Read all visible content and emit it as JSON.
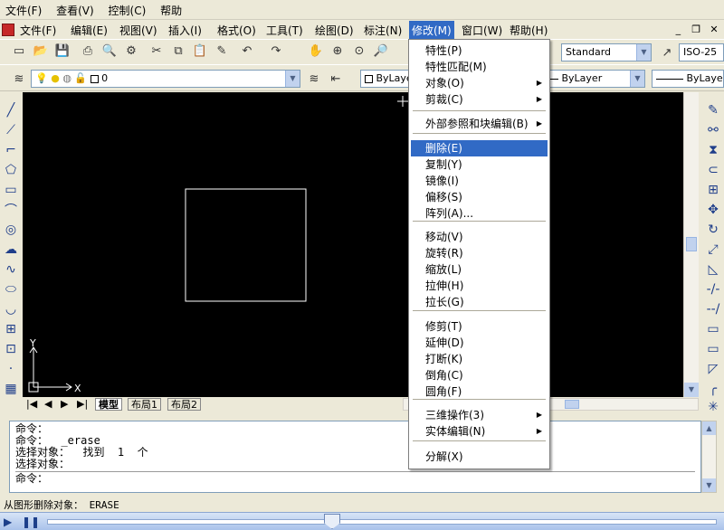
{
  "os_menu": [
    "文件(F)",
    "查看(V)",
    "控制(C)",
    "帮助"
  ],
  "app_menu": {
    "items": [
      "文件(F)",
      "编辑(E)",
      "视图(V)",
      "插入(I)",
      "格式(O)",
      "工具(T)",
      "绘图(D)",
      "标注(N)",
      "修改(M)",
      "窗口(W)",
      "帮助(H)"
    ],
    "active": "修改(M)"
  },
  "window_buttons": [
    "_",
    "❐",
    "✕"
  ],
  "toolbar": {
    "text_style": "Standard",
    "dim_style": "ISO-25",
    "layer": "0",
    "color": "ByLayer",
    "linetype": "ByLayer",
    "lineweight": "ByLayer"
  },
  "modify_menu": {
    "items": [
      {
        "label": "特性(P)",
        "submenu": false
      },
      {
        "label": "特性匹配(M)",
        "submenu": false
      },
      {
        "label": "对象(O)",
        "submenu": true
      },
      {
        "label": "剪裁(C)",
        "submenu": true
      },
      {
        "sep": true
      },
      {
        "label": "外部参照和块编辑(B)",
        "submenu": true
      },
      {
        "sep": true
      },
      {
        "label": "删除(E)",
        "submenu": false,
        "highlight": true
      },
      {
        "label": "复制(Y)",
        "submenu": false
      },
      {
        "label": "镜像(I)",
        "submenu": false
      },
      {
        "label": "偏移(S)",
        "submenu": false
      },
      {
        "label": "阵列(A)...",
        "submenu": false
      },
      {
        "sep": true
      },
      {
        "label": "移动(V)",
        "submenu": false
      },
      {
        "label": "旋转(R)",
        "submenu": false
      },
      {
        "label": "缩放(L)",
        "submenu": false
      },
      {
        "label": "拉伸(H)",
        "submenu": false
      },
      {
        "label": "拉长(G)",
        "submenu": false
      },
      {
        "sep": true
      },
      {
        "label": "修剪(T)",
        "submenu": false
      },
      {
        "label": "延伸(D)",
        "submenu": false
      },
      {
        "label": "打断(K)",
        "submenu": false
      },
      {
        "label": "倒角(C)",
        "submenu": false
      },
      {
        "label": "圆角(F)",
        "submenu": false
      },
      {
        "sep": true
      },
      {
        "label": "三维操作(3)",
        "submenu": true
      },
      {
        "label": "实体编辑(N)",
        "submenu": true
      },
      {
        "sep": true
      },
      {
        "label": "分解(X)",
        "submenu": false
      }
    ]
  },
  "ucs": {
    "x": "X",
    "y": "Y"
  },
  "layout_tabs": [
    "模型",
    "布局1",
    "布局2"
  ],
  "command_history": [
    "命令：",
    "命令：  _erase",
    "选择对象：  找到  1  个",
    "选择对象："
  ],
  "command_prompt": "命令：",
  "status_text": "从图形删除对象：   ERASE",
  "colors": {
    "canvas": "#000000",
    "highlight": "#316ac5",
    "drawing": "#ffffff"
  }
}
